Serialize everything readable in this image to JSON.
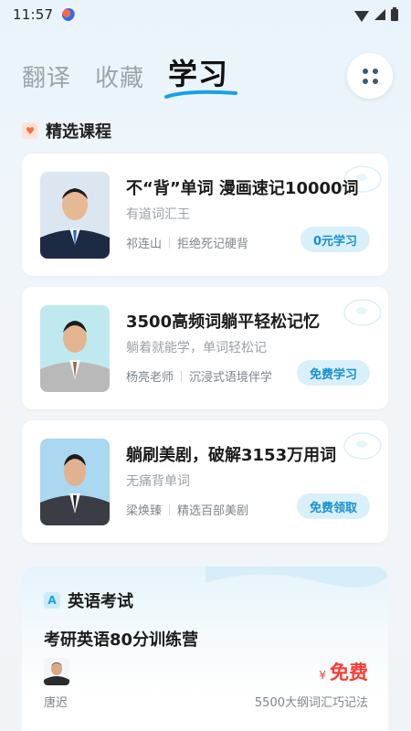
{
  "status": {
    "time": "11:57"
  },
  "tabs": [
    {
      "label": "翻译",
      "active": false
    },
    {
      "label": "收藏",
      "active": false
    },
    {
      "label": "学习",
      "active": true
    }
  ],
  "section": {
    "title": "精选课程"
  },
  "courses": [
    {
      "title": "不“背”单词 漫画速记10000词",
      "subtitle": "有道词汇王",
      "teacher": "祁连山",
      "tagline": "拒绝死记硬背",
      "button": "0元学习"
    },
    {
      "title": "3500高频词躺平轻松记忆",
      "subtitle": "躺着就能学，单词轻松记",
      "teacher": "杨亮老师",
      "tagline": "沉浸式语境伴学",
      "button": "免费学习"
    },
    {
      "title": "躺刷美剧，破解3153万用词",
      "subtitle": "无痛背单词",
      "teacher": "梁焕臻",
      "tagline": "精选百部美剧",
      "button": "免费领取"
    }
  ],
  "exam": {
    "badge": "A",
    "title": "英语考试",
    "course_title": "考研英语80分训练营",
    "teacher": "唐迟",
    "price_symbol": "¥",
    "price": "免费",
    "description": "5500大纲词汇巧记法"
  },
  "colors": {
    "accent": "#1790d0",
    "price": "#ff3b30",
    "tab_active": "#111111"
  }
}
